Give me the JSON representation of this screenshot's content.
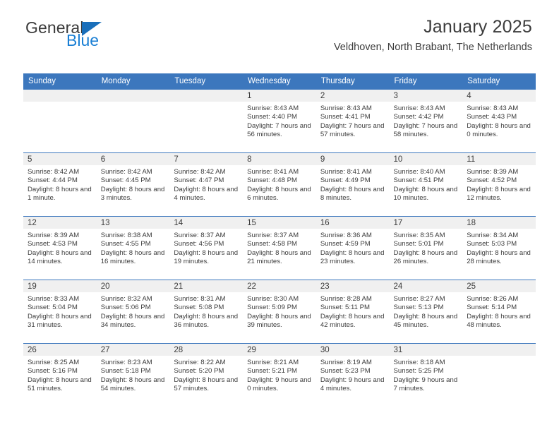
{
  "brand": {
    "name_top": "General",
    "name_bottom": "Blue",
    "triangle_color": "#1a6fba",
    "blue_color": "#1a7fd4"
  },
  "header": {
    "title": "January 2025",
    "subtitle": "Veldhoven, North Brabant, The Netherlands"
  },
  "theme": {
    "header_bg": "#3c77bd",
    "daynum_bg": "#f0f0f0",
    "text": "#3c3c3c"
  },
  "calendar": {
    "weekday_headers": [
      "Sunday",
      "Monday",
      "Tuesday",
      "Wednesday",
      "Thursday",
      "Friday",
      "Saturday"
    ],
    "labels": {
      "sunrise": "Sunrise:",
      "sunset": "Sunset:",
      "daylight": "Daylight:"
    },
    "weeks": [
      [
        {
          "day": ""
        },
        {
          "day": ""
        },
        {
          "day": ""
        },
        {
          "day": "1",
          "sunrise": "Sunrise: 8:43 AM",
          "sunset": "Sunset: 4:40 PM",
          "daylight": "Daylight: 7 hours and 56 minutes."
        },
        {
          "day": "2",
          "sunrise": "Sunrise: 8:43 AM",
          "sunset": "Sunset: 4:41 PM",
          "daylight": "Daylight: 7 hours and 57 minutes."
        },
        {
          "day": "3",
          "sunrise": "Sunrise: 8:43 AM",
          "sunset": "Sunset: 4:42 PM",
          "daylight": "Daylight: 7 hours and 58 minutes."
        },
        {
          "day": "4",
          "sunrise": "Sunrise: 8:43 AM",
          "sunset": "Sunset: 4:43 PM",
          "daylight": "Daylight: 8 hours and 0 minutes."
        }
      ],
      [
        {
          "day": "5",
          "sunrise": "Sunrise: 8:42 AM",
          "sunset": "Sunset: 4:44 PM",
          "daylight": "Daylight: 8 hours and 1 minute."
        },
        {
          "day": "6",
          "sunrise": "Sunrise: 8:42 AM",
          "sunset": "Sunset: 4:45 PM",
          "daylight": "Daylight: 8 hours and 3 minutes."
        },
        {
          "day": "7",
          "sunrise": "Sunrise: 8:42 AM",
          "sunset": "Sunset: 4:47 PM",
          "daylight": "Daylight: 8 hours and 4 minutes."
        },
        {
          "day": "8",
          "sunrise": "Sunrise: 8:41 AM",
          "sunset": "Sunset: 4:48 PM",
          "daylight": "Daylight: 8 hours and 6 minutes."
        },
        {
          "day": "9",
          "sunrise": "Sunrise: 8:41 AM",
          "sunset": "Sunset: 4:49 PM",
          "daylight": "Daylight: 8 hours and 8 minutes."
        },
        {
          "day": "10",
          "sunrise": "Sunrise: 8:40 AM",
          "sunset": "Sunset: 4:51 PM",
          "daylight": "Daylight: 8 hours and 10 minutes."
        },
        {
          "day": "11",
          "sunrise": "Sunrise: 8:39 AM",
          "sunset": "Sunset: 4:52 PM",
          "daylight": "Daylight: 8 hours and 12 minutes."
        }
      ],
      [
        {
          "day": "12",
          "sunrise": "Sunrise: 8:39 AM",
          "sunset": "Sunset: 4:53 PM",
          "daylight": "Daylight: 8 hours and 14 minutes."
        },
        {
          "day": "13",
          "sunrise": "Sunrise: 8:38 AM",
          "sunset": "Sunset: 4:55 PM",
          "daylight": "Daylight: 8 hours and 16 minutes."
        },
        {
          "day": "14",
          "sunrise": "Sunrise: 8:37 AM",
          "sunset": "Sunset: 4:56 PM",
          "daylight": "Daylight: 8 hours and 19 minutes."
        },
        {
          "day": "15",
          "sunrise": "Sunrise: 8:37 AM",
          "sunset": "Sunset: 4:58 PM",
          "daylight": "Daylight: 8 hours and 21 minutes."
        },
        {
          "day": "16",
          "sunrise": "Sunrise: 8:36 AM",
          "sunset": "Sunset: 4:59 PM",
          "daylight": "Daylight: 8 hours and 23 minutes."
        },
        {
          "day": "17",
          "sunrise": "Sunrise: 8:35 AM",
          "sunset": "Sunset: 5:01 PM",
          "daylight": "Daylight: 8 hours and 26 minutes."
        },
        {
          "day": "18",
          "sunrise": "Sunrise: 8:34 AM",
          "sunset": "Sunset: 5:03 PM",
          "daylight": "Daylight: 8 hours and 28 minutes."
        }
      ],
      [
        {
          "day": "19",
          "sunrise": "Sunrise: 8:33 AM",
          "sunset": "Sunset: 5:04 PM",
          "daylight": "Daylight: 8 hours and 31 minutes."
        },
        {
          "day": "20",
          "sunrise": "Sunrise: 8:32 AM",
          "sunset": "Sunset: 5:06 PM",
          "daylight": "Daylight: 8 hours and 34 minutes."
        },
        {
          "day": "21",
          "sunrise": "Sunrise: 8:31 AM",
          "sunset": "Sunset: 5:08 PM",
          "daylight": "Daylight: 8 hours and 36 minutes."
        },
        {
          "day": "22",
          "sunrise": "Sunrise: 8:30 AM",
          "sunset": "Sunset: 5:09 PM",
          "daylight": "Daylight: 8 hours and 39 minutes."
        },
        {
          "day": "23",
          "sunrise": "Sunrise: 8:28 AM",
          "sunset": "Sunset: 5:11 PM",
          "daylight": "Daylight: 8 hours and 42 minutes."
        },
        {
          "day": "24",
          "sunrise": "Sunrise: 8:27 AM",
          "sunset": "Sunset: 5:13 PM",
          "daylight": "Daylight: 8 hours and 45 minutes."
        },
        {
          "day": "25",
          "sunrise": "Sunrise: 8:26 AM",
          "sunset": "Sunset: 5:14 PM",
          "daylight": "Daylight: 8 hours and 48 minutes."
        }
      ],
      [
        {
          "day": "26",
          "sunrise": "Sunrise: 8:25 AM",
          "sunset": "Sunset: 5:16 PM",
          "daylight": "Daylight: 8 hours and 51 minutes."
        },
        {
          "day": "27",
          "sunrise": "Sunrise: 8:23 AM",
          "sunset": "Sunset: 5:18 PM",
          "daylight": "Daylight: 8 hours and 54 minutes."
        },
        {
          "day": "28",
          "sunrise": "Sunrise: 8:22 AM",
          "sunset": "Sunset: 5:20 PM",
          "daylight": "Daylight: 8 hours and 57 minutes."
        },
        {
          "day": "29",
          "sunrise": "Sunrise: 8:21 AM",
          "sunset": "Sunset: 5:21 PM",
          "daylight": "Daylight: 9 hours and 0 minutes."
        },
        {
          "day": "30",
          "sunrise": "Sunrise: 8:19 AM",
          "sunset": "Sunset: 5:23 PM",
          "daylight": "Daylight: 9 hours and 4 minutes."
        },
        {
          "day": "31",
          "sunrise": "Sunrise: 8:18 AM",
          "sunset": "Sunset: 5:25 PM",
          "daylight": "Daylight: 9 hours and 7 minutes."
        },
        {
          "day": ""
        }
      ]
    ]
  }
}
